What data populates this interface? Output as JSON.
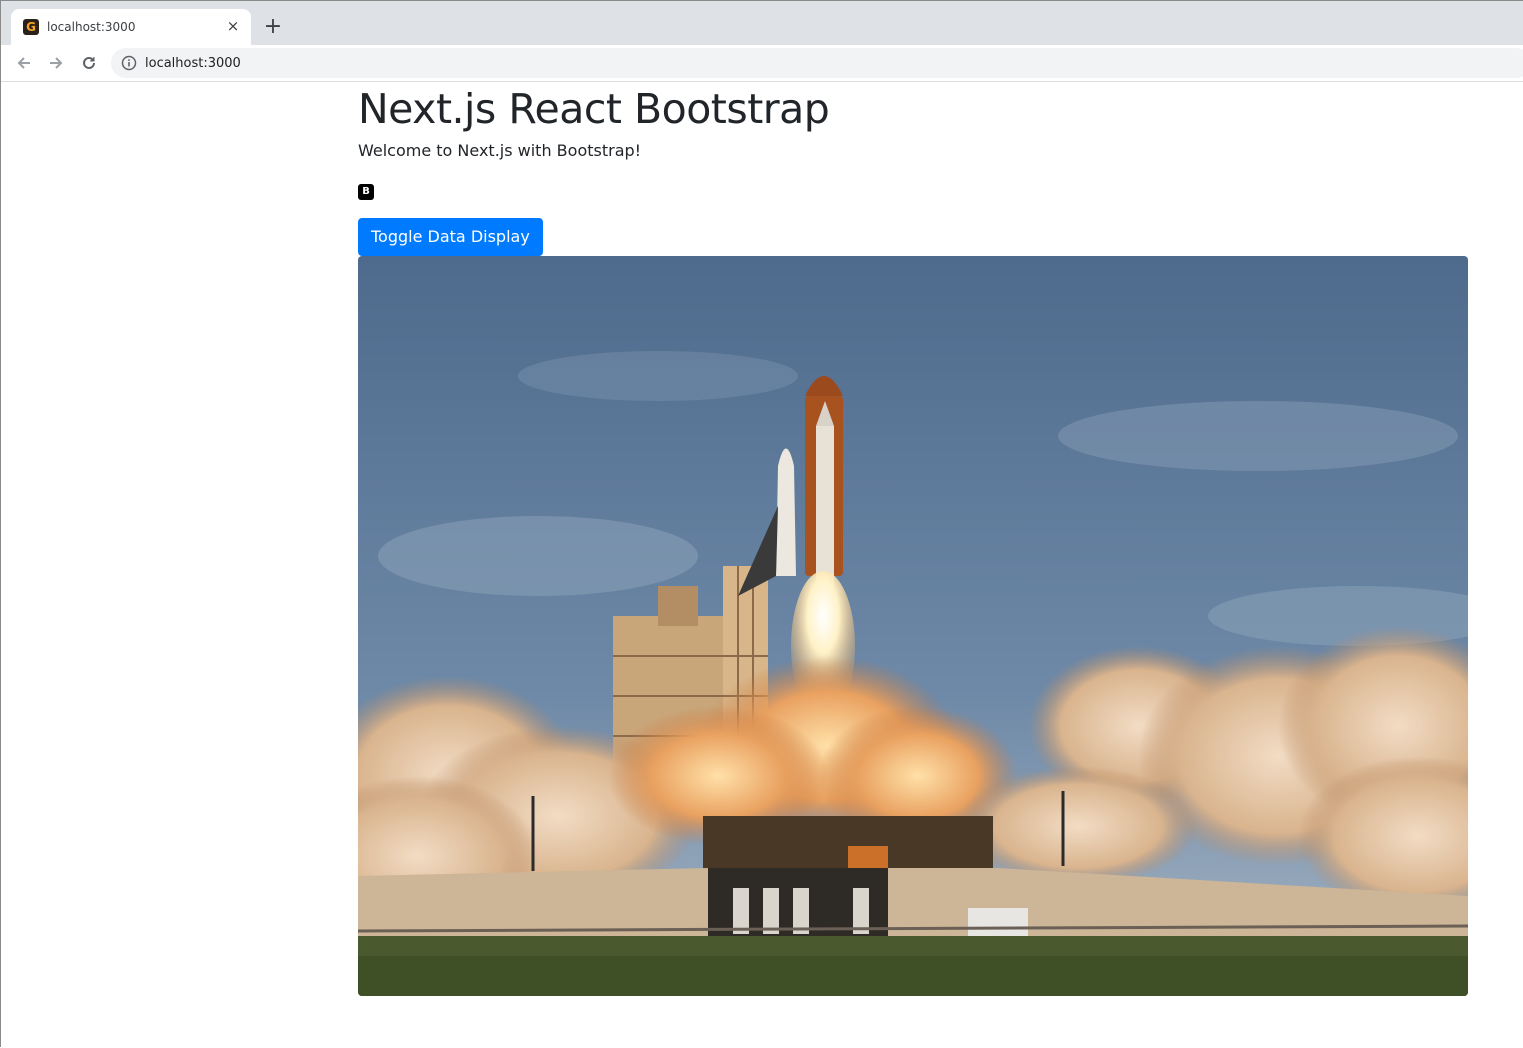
{
  "browser": {
    "tab": {
      "title": "localhost:3000",
      "favicon_letter": "G",
      "close_glyph": "×"
    },
    "new_tab_glyph": "+",
    "address": {
      "url": "localhost:3000"
    }
  },
  "page": {
    "title": "Next.js React Bootstrap",
    "lead": "Welcome to Next.js with Bootstrap!",
    "badge_letter": "B",
    "toggle_button": "Toggle Data Display",
    "accent_color": "#007bff"
  }
}
